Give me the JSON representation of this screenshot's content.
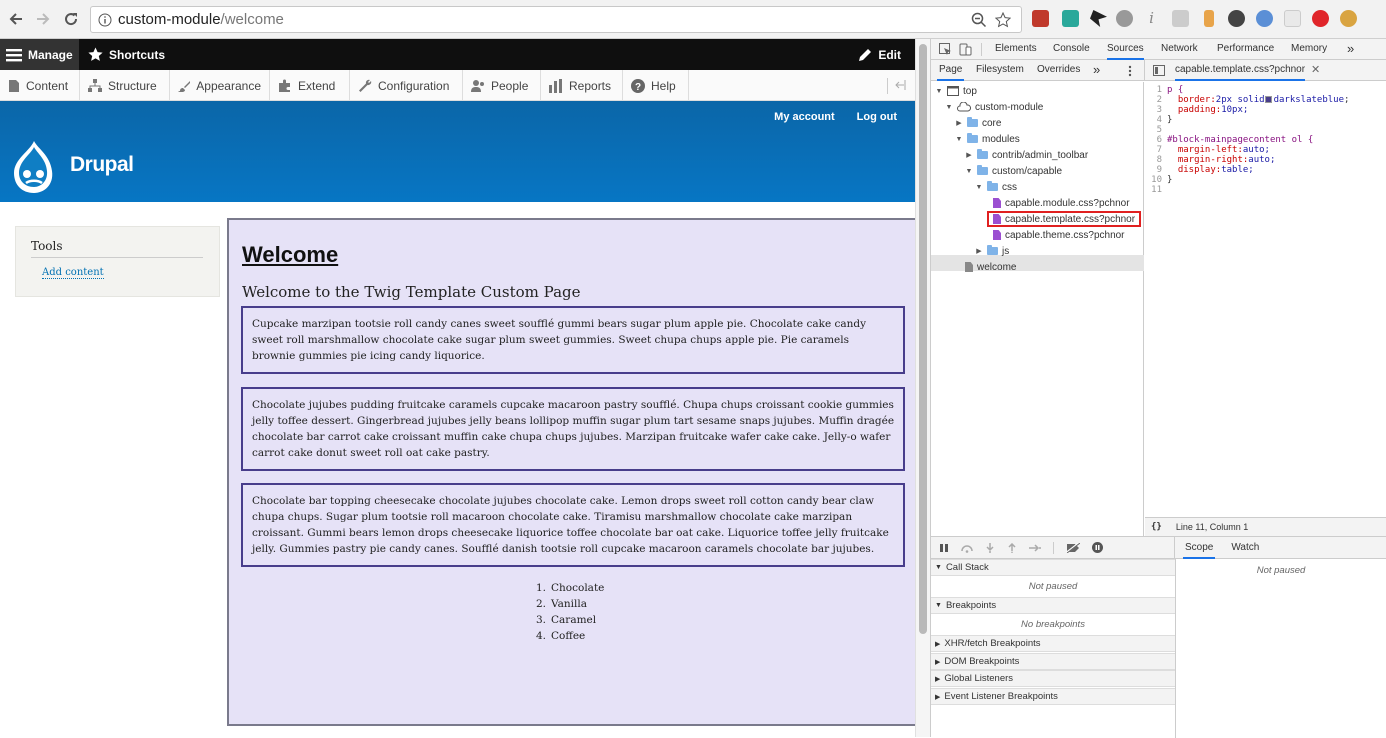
{
  "browser": {
    "url_host": "custom-module",
    "url_path": "/welcome"
  },
  "toolbar": {
    "manage": "Manage",
    "shortcuts": "Shortcuts",
    "edit": "Edit",
    "tray": [
      "Content",
      "Structure",
      "Appearance",
      "Extend",
      "Configuration",
      "People",
      "Reports",
      "Help"
    ]
  },
  "header": {
    "my_account": "My account",
    "log_out": "Log out",
    "site_name": "Drupal"
  },
  "sidebar": {
    "title": "Tools",
    "link": "Add content"
  },
  "main": {
    "title": "Welcome",
    "subtitle": "Welcome to the Twig Template Custom Page",
    "paragraphs": [
      "Cupcake marzipan tootsie roll candy canes sweet soufflé gummi bears sugar plum apple pie. Chocolate cake candy sweet roll marshmallow chocolate cake sugar plum sweet gummies. Sweet chupa chups apple pie. Pie caramels brownie gummies pie icing candy liquorice.",
      "Chocolate jujubes pudding fruitcake caramels cupcake macaroon pastry soufflé. Chupa chups croissant cookie gummies jelly toffee dessert. Gingerbread jujubes jelly beans lollipop muffin sugar plum tart sesame snaps jujubes. Muffin dragée chocolate bar carrot cake croissant muffin cake chupa chups jujubes. Marzipan fruitcake wafer cake cake. Jelly-o wafer carrot cake donut sweet roll oat cake pastry.",
      "Chocolate bar topping cheesecake chocolate jujubes chocolate cake. Lemon drops sweet roll cotton candy bear claw chupa chups. Sugar plum tootsie roll macaroon chocolate cake. Tiramisu marshmallow chocolate cake marzipan croissant. Gummi bears lemon drops cheesecake liquorice toffee chocolate bar oat cake. Liquorice toffee jelly fruitcake jelly. Gummies pastry pie candy canes. Soufflé danish tootsie roll cupcake macaroon caramels chocolate bar jujubes."
    ],
    "list": [
      {
        "num": "1.",
        "text": "Chocolate"
      },
      {
        "num": "2.",
        "text": "Vanilla"
      },
      {
        "num": "3.",
        "text": "Caramel"
      },
      {
        "num": "4.",
        "text": "Coffee"
      }
    ]
  },
  "devtools": {
    "tabs": [
      "Elements",
      "Console",
      "Sources",
      "Network",
      "Performance",
      "Memory"
    ],
    "active_tab": "Sources",
    "more": "»",
    "nav_tabs": [
      "Page",
      "Filesystem",
      "Overrides"
    ],
    "open_file": "capable.template.css?pchnor",
    "tree": {
      "top": "top",
      "origin": "custom-module",
      "core": "core",
      "modules": "modules",
      "contrib": "contrib/admin_toolbar",
      "custom": "custom/capable",
      "css": "css",
      "file1": "capable.module.css?pchnor",
      "file2": "capable.template.css?pchnor",
      "file3": "capable.theme.css?pchnor",
      "js": "js",
      "welcome": "welcome"
    },
    "code": {
      "l1": "p {",
      "l2_prop": "border:",
      "l2_val": " 2px solid ",
      "l2_color": "darkslateblue",
      "l3_prop": "padding:",
      "l3_val": " 10px;",
      "l4": "}",
      "l6": "#block-mainpagecontent ol {",
      "l7_prop": "margin-left:",
      "l7_val": " auto;",
      "l8_prop": "margin-right:",
      "l8_val": " auto;",
      "l9_prop": "display:",
      "l9_val": " table;",
      "l10": "}",
      "line_numbers": [
        "1",
        "2",
        "3",
        "4",
        "5",
        "6",
        "7",
        "8",
        "9",
        "10",
        "11"
      ]
    },
    "status": "Line 11, Column 1",
    "status_icon": "{}",
    "debugger": {
      "call_stack": "Call Stack",
      "not_paused": "Not paused",
      "breakpoints": "Breakpoints",
      "no_breakpoints": "No breakpoints",
      "xhr": "XHR/fetch Breakpoints",
      "dom": "DOM Breakpoints",
      "global": "Global Listeners",
      "event": "Event Listener Breakpoints",
      "scope": "Scope",
      "watch": "Watch",
      "scope_not_paused": "Not paused"
    }
  },
  "colors": {
    "swatch": "#483d8b",
    "drupal_blue": "#0776c4",
    "content_bg": "#e6e2f7"
  }
}
